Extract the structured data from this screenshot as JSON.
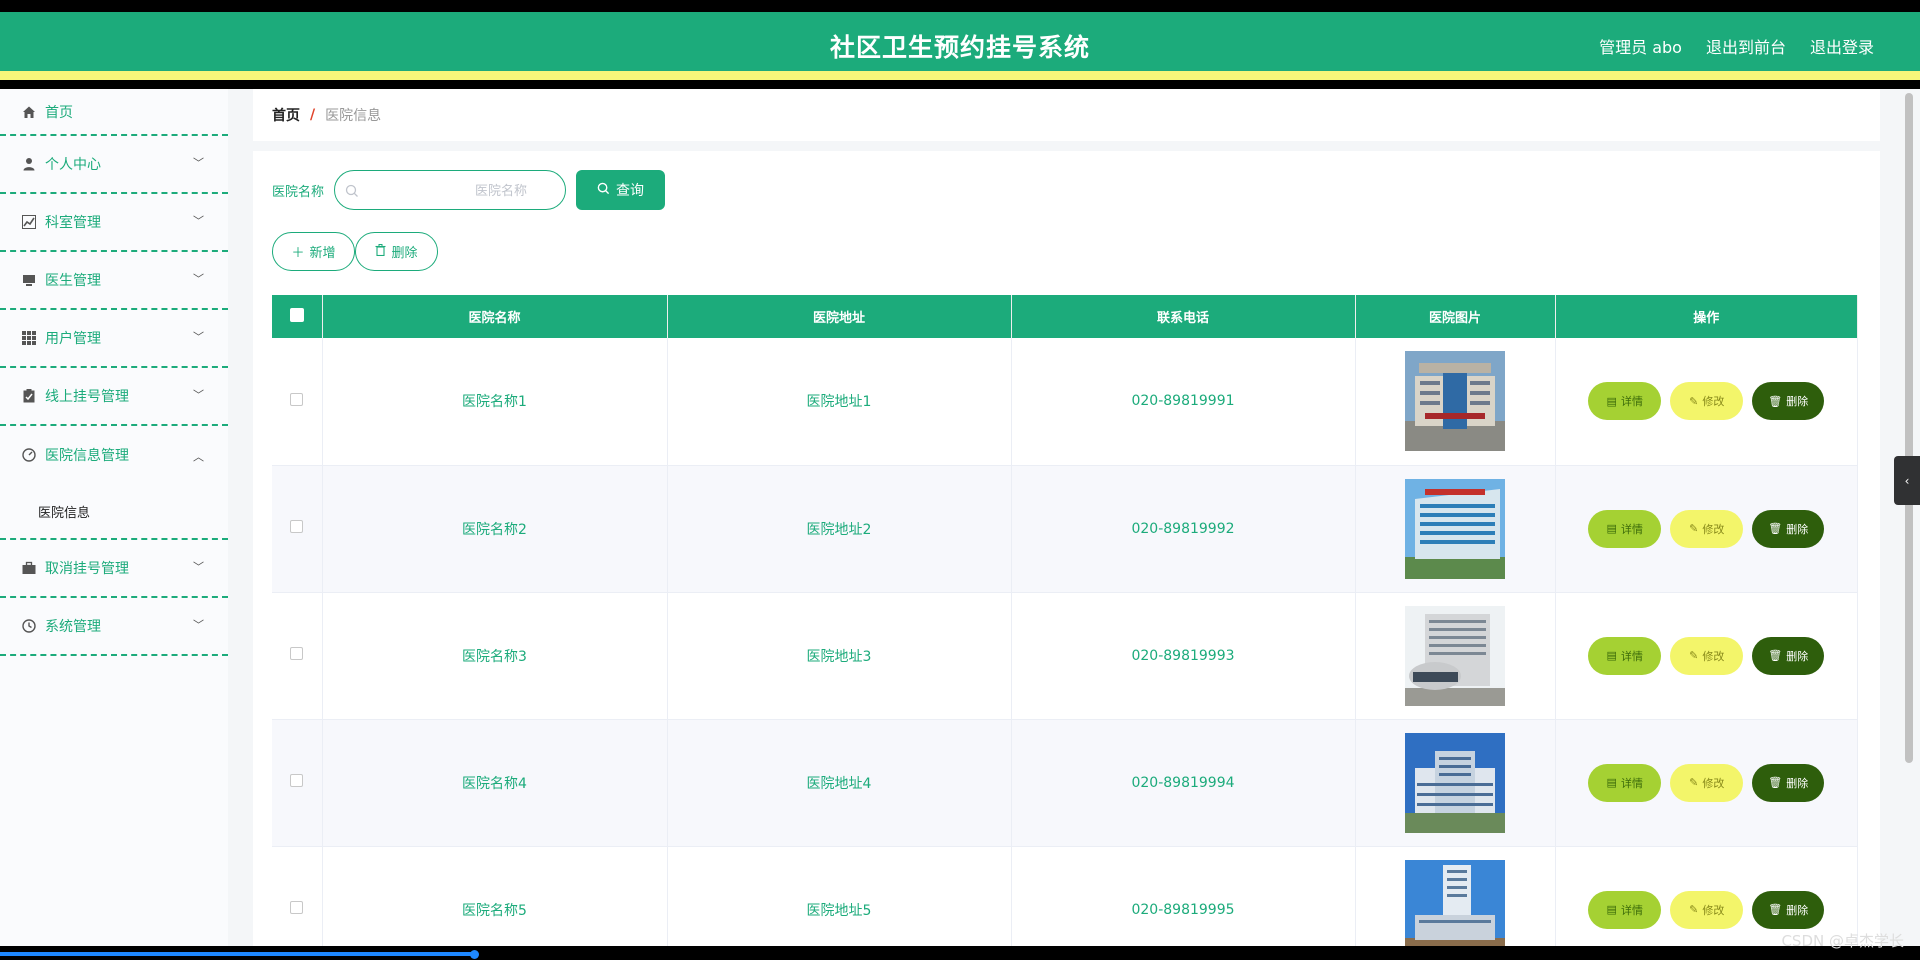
{
  "header": {
    "title": "社区卫生预约挂号系统",
    "user": "管理员 abo",
    "to_front": "退出到前台",
    "logout": "退出登录"
  },
  "sidebar": {
    "items": [
      {
        "label": "首页",
        "icon": "home-icon"
      },
      {
        "label": "个人中心",
        "icon": "user-icon"
      },
      {
        "label": "科室管理",
        "icon": "chart-icon"
      },
      {
        "label": "医生管理",
        "icon": "monitor-icon"
      },
      {
        "label": "用户管理",
        "icon": "grid-icon"
      },
      {
        "label": "线上挂号管理",
        "icon": "clipboard-icon"
      },
      {
        "label": "医院信息管理",
        "icon": "gauge-icon",
        "expanded": true
      },
      {
        "label": "取消挂号管理",
        "icon": "briefcase-icon"
      },
      {
        "label": "系统管理",
        "icon": "clock-icon"
      }
    ],
    "sub_item": "医院信息"
  },
  "breadcrumb": {
    "home": "首页",
    "sep": "/",
    "current": "医院信息"
  },
  "search": {
    "label": "医院名称",
    "placeholder": "医院名称",
    "value": "",
    "button": "查询"
  },
  "actions": {
    "add": "新增",
    "delete": "删除"
  },
  "table": {
    "columns": [
      "医院名称",
      "医院地址",
      "联系电话",
      "医院图片",
      "操作"
    ],
    "rows": [
      {
        "name": "医院名称1",
        "address": "医院地址1",
        "phone": "020-89819991"
      },
      {
        "name": "医院名称2",
        "address": "医院地址2",
        "phone": "020-89819992"
      },
      {
        "name": "医院名称3",
        "address": "医院地址3",
        "phone": "020-89819993"
      },
      {
        "name": "医院名称4",
        "address": "医院地址4",
        "phone": "020-89819994"
      },
      {
        "name": "医院名称5",
        "address": "医院地址5",
        "phone": "020-89819995"
      }
    ],
    "ops": {
      "detail": "详情",
      "edit": "修改",
      "remove": "删除"
    }
  },
  "watermark": "CSDN @卓杰学长",
  "colors": {
    "primary": "#1cab7b",
    "accent_yellow": "#f6f77a",
    "detail": "#a5d133",
    "edit": "#f3f56a",
    "remove": "#2e5e0c"
  }
}
